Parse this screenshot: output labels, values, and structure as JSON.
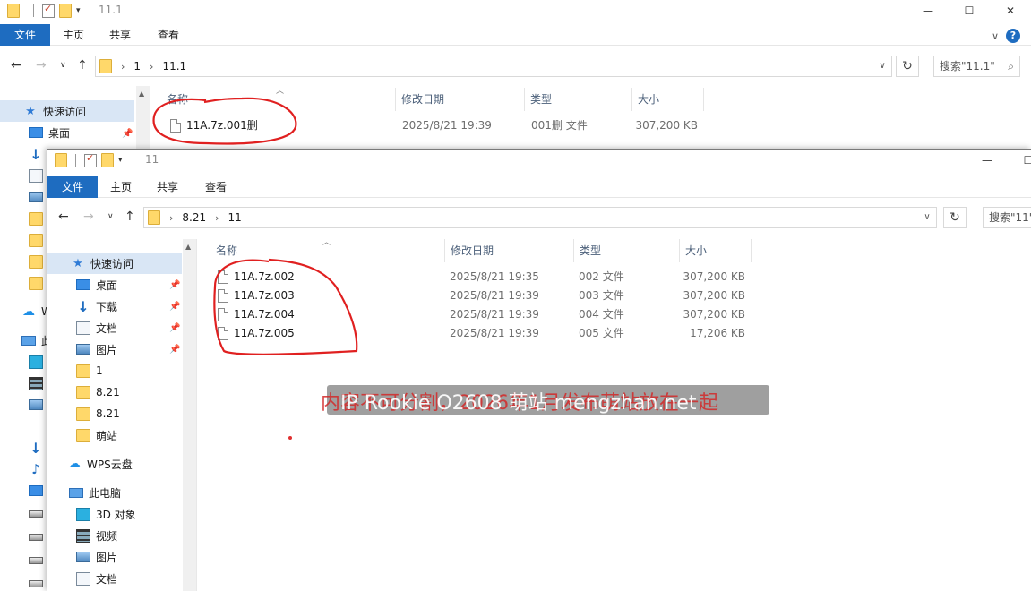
{
  "back_window": {
    "title": "11.1",
    "ribbon_tabs": [
      "文件",
      "主页",
      "共享",
      "查看"
    ],
    "address": [
      "1",
      "11.1"
    ],
    "search_placeholder": "搜索\"11.1\"",
    "columns": [
      "名称",
      "修改日期",
      "类型",
      "大小"
    ],
    "files": [
      {
        "name": "11A.7z.001删",
        "date": "2025/8/21 19:39",
        "type": "001删 文件",
        "size": "307,200 KB"
      }
    ],
    "nav": {
      "quick_access": "快速访问",
      "desktop": "桌面",
      "wps_cloud_partial": "W",
      "this_pc_partial": "此"
    }
  },
  "front_window": {
    "title": "11",
    "ribbon_tabs": [
      "文件",
      "主页",
      "共享",
      "查看"
    ],
    "address": [
      "8.21",
      "11"
    ],
    "search_placeholder": "搜索\"11\"",
    "columns": [
      "名称",
      "修改日期",
      "类型",
      "大小"
    ],
    "files": [
      {
        "name": "11A.7z.002",
        "date": "2025/8/21 19:35",
        "type": "002 文件",
        "size": "307,200 KB"
      },
      {
        "name": "11A.7z.003",
        "date": "2025/8/21 19:39",
        "type": "003 文件",
        "size": "307,200 KB"
      },
      {
        "name": "11A.7z.004",
        "date": "2025/8/21 19:39",
        "type": "004 文件",
        "size": "307,200 KB"
      },
      {
        "name": "11A.7z.005",
        "date": "2025/8/21 19:39",
        "type": "005 文件",
        "size": "17,206 KB"
      }
    ],
    "nav": {
      "quick_access": "快速访问",
      "desktop": "桌面",
      "downloads": "下载",
      "documents": "文档",
      "pictures": "图片",
      "folder_1": "1",
      "folder_821a": "8.21",
      "folder_821b": "8.21",
      "folder_mengzhan": "萌站",
      "wps_cloud": "WPS云盘",
      "this_pc": "此电脑",
      "objects_3d": "3D 对象",
      "videos": "视频",
      "pictures_pc": "图片",
      "documents_pc": "文档"
    }
  },
  "watermark": {
    "red_text": "内容不可分割，2026年1月发布萌站放在一起",
    "white_text": "IP  Rookie  O2608  萌站  mengzhan.net"
  },
  "window_buttons": {
    "minimize": "—",
    "maximize": "☐",
    "close": "✕"
  }
}
